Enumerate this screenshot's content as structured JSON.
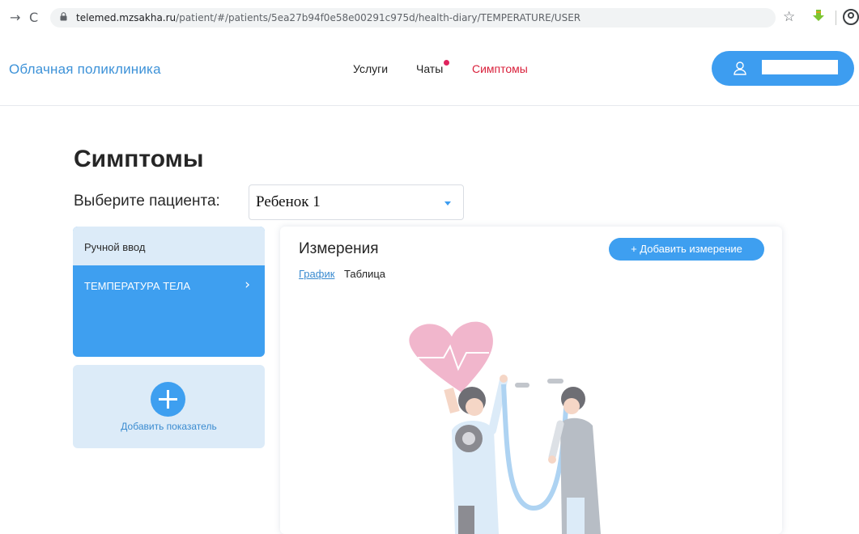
{
  "browser": {
    "url_host": "telemed.mzsakha.ru",
    "url_path": "/patient/#/patients/5ea27b94f0e58e00291c975d/health-diary/TEMPERATURE/USER",
    "back_icon": "arrow-right-icon",
    "reload_icon": "reload-icon",
    "bookmark_icon": "star-icon",
    "extension_icon": "download-extension-icon",
    "profile_icon": "profile-icon"
  },
  "header": {
    "brand": "Облачная поликлиника",
    "nav": {
      "services": "Услуги",
      "chats": "Чаты",
      "symptoms": "Симптомы"
    },
    "chat_unread_dot_color": "#e0245e",
    "active_nav_color": "#d91f3a",
    "user_icon": "user-icon"
  },
  "page": {
    "title": "Симптомы",
    "patient_label": "Выберите пациента:",
    "patient_selected": "Ребенок 1"
  },
  "sidebar": {
    "header": "Ручной ввод",
    "items": [
      {
        "label": "ТЕМПЕРАТУРА ТЕЛА",
        "icon": "chevron-right-icon"
      }
    ],
    "add_label": "Добавить показатель"
  },
  "panel": {
    "title": "Измерения",
    "add_button": "+ Добавить измерение",
    "tabs": [
      "График",
      "Таблица"
    ],
    "illustration": "doctors-with-heart-illustration"
  },
  "colors": {
    "accent": "#3e9ff0",
    "brand": "#3d92d8",
    "light_blue": "#dcebf8"
  }
}
